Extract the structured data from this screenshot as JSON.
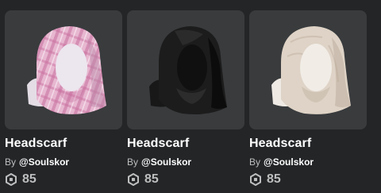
{
  "items": [
    {
      "name": "Headscarf",
      "by_label": "By",
      "creator": "@Soulskor",
      "price": "85",
      "variant": "pink-plaid",
      "colors": {
        "scarf": "#e7b7d0",
        "stripe": "#c76d9d",
        "shade": "#b887a6",
        "face": "#ece6ef"
      }
    },
    {
      "name": "Headscarf",
      "by_label": "By",
      "creator": "@Soulskor",
      "price": "85",
      "variant": "black",
      "colors": {
        "scarf": "#1c1c1c",
        "stripe": "#2c2c2c",
        "shade": "#0c0c0c",
        "face": "#141414"
      }
    },
    {
      "name": "Headscarf",
      "by_label": "By",
      "creator": "@Soulskor",
      "price": "85",
      "variant": "cream",
      "colors": {
        "scarf": "#ded3c6",
        "stripe": "#cbbdae",
        "shade": "#b9aa9a",
        "face": "#f1ece6"
      }
    }
  ],
  "icons": {
    "price": "robux-icon"
  }
}
